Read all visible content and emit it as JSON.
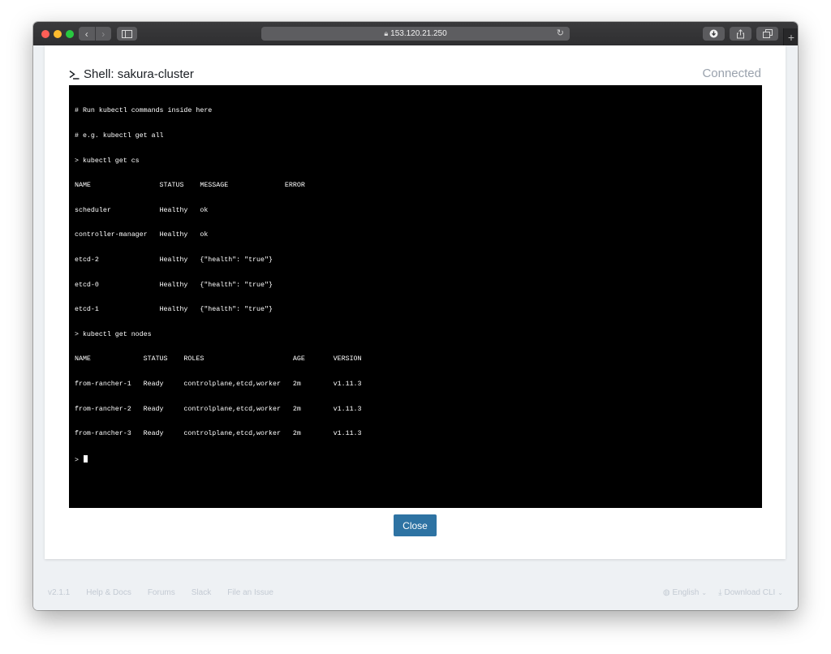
{
  "browser": {
    "url": "153.120.21.250",
    "icons": {
      "lock": "lock-icon",
      "reload": "reload-icon",
      "download": "download-icon",
      "share": "share-icon",
      "tabs": "tabs-overview-icon",
      "new_tab": "plus-icon",
      "back": "chevron-left-icon",
      "forward": "chevron-right-icon",
      "sidebar": "sidebar-icon"
    }
  },
  "modal": {
    "title": "Shell: sakura-cluster",
    "status": "Connected",
    "close_label": "Close"
  },
  "terminal": {
    "lines": [
      "# Run kubectl commands inside here",
      "# e.g. kubectl get all",
      "> kubectl get cs",
      "NAME                 STATUS    MESSAGE              ERROR",
      "scheduler            Healthy   ok",
      "controller-manager   Healthy   ok",
      "etcd-2               Healthy   {\"health\": \"true\"}",
      "etcd-0               Healthy   {\"health\": \"true\"}",
      "etcd-1               Healthy   {\"health\": \"true\"}",
      "> kubectl get nodes",
      "NAME             STATUS    ROLES                      AGE       VERSION",
      "from-rancher-1   Ready     controlplane,etcd,worker   2m        v1.11.3",
      "from-rancher-2   Ready     controlplane,etcd,worker   2m        v1.11.3",
      "from-rancher-3   Ready     controlplane,etcd,worker   2m        v1.11.3"
    ],
    "prompt": "> "
  },
  "footer": {
    "version": "v2.1.1",
    "links": [
      "Help & Docs",
      "Forums",
      "Slack",
      "File an Issue"
    ],
    "language": "English",
    "download_cli": "Download CLI"
  },
  "colors": {
    "accent": "#2e73a3",
    "terminal_bg": "#000000",
    "status_muted": "#9aa2ad"
  }
}
